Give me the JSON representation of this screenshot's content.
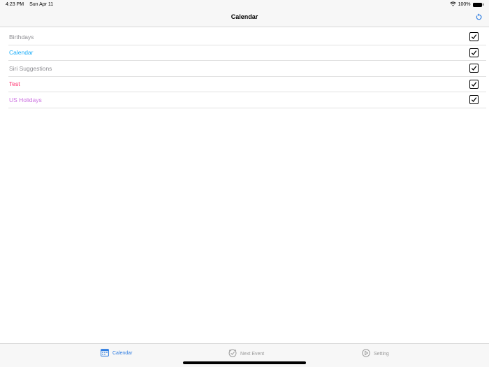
{
  "status_bar": {
    "time": "4:23 PM",
    "date": "Sun Apr 11",
    "battery_text": "100%",
    "battery_level": 1.0,
    "icons": [
      "wifi-icon",
      "battery-icon"
    ]
  },
  "nav": {
    "title": "Calendar",
    "refresh_icon": "refresh-icon"
  },
  "calendars": [
    {
      "label": "Birthdays",
      "color": "#8e8e93",
      "checked": true
    },
    {
      "label": "Calendar",
      "color": "#1badf8",
      "checked": true
    },
    {
      "label": "Siri Suggestions",
      "color": "#8e8e93",
      "checked": true
    },
    {
      "label": "Test",
      "color": "#ff2968",
      "checked": true
    },
    {
      "label": "US Holidays",
      "color": "#cc73e1",
      "checked": true
    }
  ],
  "tabs": [
    {
      "label": "Calendar",
      "icon": "calendar-icon",
      "selected": true
    },
    {
      "label": "Next Event",
      "icon": "clock-icon",
      "selected": false
    },
    {
      "label": "Setting",
      "icon": "play-circle-icon",
      "selected": false
    }
  ],
  "colors": {
    "accent": "#2f7de1",
    "tab_inactive": "#999999",
    "bar_background": "#f7f7f7"
  }
}
